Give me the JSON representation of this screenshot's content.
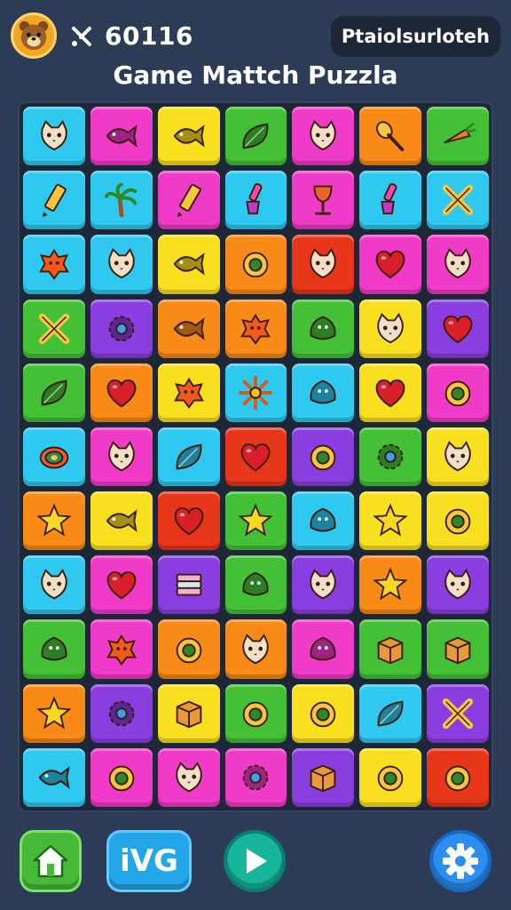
{
  "header": {
    "score": "60116",
    "player_label": "Ptaiolsurloteh",
    "title": "Game Mattch Puzzla"
  },
  "bottom": {
    "iv_label": "iVG"
  },
  "colors": {
    "background": "#2c3c56",
    "board": "#1d2738",
    "cyan": "#2ec8f0",
    "magenta": "#f03ac8",
    "yellow": "#f8e020",
    "green": "#44c036",
    "orange": "#f88a18",
    "purple": "#8a3ee0",
    "red": "#e8361a"
  },
  "board": {
    "columns": 7,
    "rows": 11,
    "tiles": [
      {
        "color": "#2ec8f0",
        "icon": "cat-face"
      },
      {
        "color": "#f03ac8",
        "icon": "fish"
      },
      {
        "color": "#f8e020",
        "icon": "fish"
      },
      {
        "color": "#44c036",
        "icon": "leaf"
      },
      {
        "color": "#f03ac8",
        "icon": "cat-face"
      },
      {
        "color": "#f88a18",
        "icon": "spoon"
      },
      {
        "color": "#44c036",
        "icon": "carrot"
      },
      {
        "color": "#2ec8f0",
        "icon": "crayon"
      },
      {
        "color": "#2ec8f0",
        "icon": "palm"
      },
      {
        "color": "#f03ac8",
        "icon": "crayon"
      },
      {
        "color": "#2ec8f0",
        "icon": "brush"
      },
      {
        "color": "#f03ac8",
        "icon": "goblet"
      },
      {
        "color": "#2ec8f0",
        "icon": "brush"
      },
      {
        "color": "#2ec8f0",
        "icon": "cross"
      },
      {
        "color": "#2ec8f0",
        "icon": "star-blob"
      },
      {
        "color": "#2ec8f0",
        "icon": "cat-face"
      },
      {
        "color": "#f8e020",
        "icon": "fish"
      },
      {
        "color": "#f88a18",
        "icon": "ring"
      },
      {
        "color": "#e8361a",
        "icon": "cat-face"
      },
      {
        "color": "#f03ac8",
        "icon": "heart"
      },
      {
        "color": "#f03ac8",
        "icon": "cat-face"
      },
      {
        "color": "#44c036",
        "icon": "cross"
      },
      {
        "color": "#8a3ee0",
        "icon": "gear"
      },
      {
        "color": "#f88a18",
        "icon": "fish"
      },
      {
        "color": "#f88a18",
        "icon": "star-blob"
      },
      {
        "color": "#44c036",
        "icon": "blob"
      },
      {
        "color": "#f8e020",
        "icon": "cat-face"
      },
      {
        "color": "#8a3ee0",
        "icon": "heart"
      },
      {
        "color": "#44c036",
        "icon": "leaf"
      },
      {
        "color": "#f88a18",
        "icon": "heart"
      },
      {
        "color": "#f8e020",
        "icon": "star-blob"
      },
      {
        "color": "#2ec8f0",
        "icon": "sun"
      },
      {
        "color": "#2ec8f0",
        "icon": "blob"
      },
      {
        "color": "#f8e020",
        "icon": "heart"
      },
      {
        "color": "#f03ac8",
        "icon": "ring"
      },
      {
        "color": "#2ec8f0",
        "icon": "shell"
      },
      {
        "color": "#f03ac8",
        "icon": "cat-face"
      },
      {
        "color": "#2ec8f0",
        "icon": "leaf"
      },
      {
        "color": "#e8361a",
        "icon": "heart"
      },
      {
        "color": "#8a3ee0",
        "icon": "ring"
      },
      {
        "color": "#44c036",
        "icon": "gear"
      },
      {
        "color": "#f8e020",
        "icon": "cat-face"
      },
      {
        "color": "#f88a18",
        "icon": "star"
      },
      {
        "color": "#f8e020",
        "icon": "fish"
      },
      {
        "color": "#e8361a",
        "icon": "heart"
      },
      {
        "color": "#44c036",
        "icon": "star"
      },
      {
        "color": "#2ec8f0",
        "icon": "blob"
      },
      {
        "color": "#f8e020",
        "icon": "star"
      },
      {
        "color": "#f8e020",
        "icon": "ring"
      },
      {
        "color": "#2ec8f0",
        "icon": "cat-face"
      },
      {
        "color": "#f03ac8",
        "icon": "heart"
      },
      {
        "color": "#8a3ee0",
        "icon": "stack"
      },
      {
        "color": "#44c036",
        "icon": "blob"
      },
      {
        "color": "#8a3ee0",
        "icon": "cat-face"
      },
      {
        "color": "#f88a18",
        "icon": "star"
      },
      {
        "color": "#8a3ee0",
        "icon": "cat-face"
      },
      {
        "color": "#44c036",
        "icon": "blob"
      },
      {
        "color": "#f03ac8",
        "icon": "star-blob"
      },
      {
        "color": "#f88a18",
        "icon": "ring"
      },
      {
        "color": "#f88a18",
        "icon": "cat-face"
      },
      {
        "color": "#f03ac8",
        "icon": "blob"
      },
      {
        "color": "#44c036",
        "icon": "box"
      },
      {
        "color": "#44c036",
        "icon": "box"
      },
      {
        "color": "#f88a18",
        "icon": "star"
      },
      {
        "color": "#8a3ee0",
        "icon": "gear"
      },
      {
        "color": "#f8e020",
        "icon": "box"
      },
      {
        "color": "#44c036",
        "icon": "ring"
      },
      {
        "color": "#f8e020",
        "icon": "ring"
      },
      {
        "color": "#2ec8f0",
        "icon": "leaf"
      },
      {
        "color": "#8a3ee0",
        "icon": "cross"
      },
      {
        "color": "#2ec8f0",
        "icon": "fish"
      },
      {
        "color": "#f03ac8",
        "icon": "ring"
      },
      {
        "color": "#f03ac8",
        "icon": "cat-face"
      },
      {
        "color": "#f03ac8",
        "icon": "gear"
      },
      {
        "color": "#8a3ee0",
        "icon": "box"
      },
      {
        "color": "#f8e020",
        "icon": "ring"
      },
      {
        "color": "#e8361a",
        "icon": "ring"
      }
    ]
  }
}
